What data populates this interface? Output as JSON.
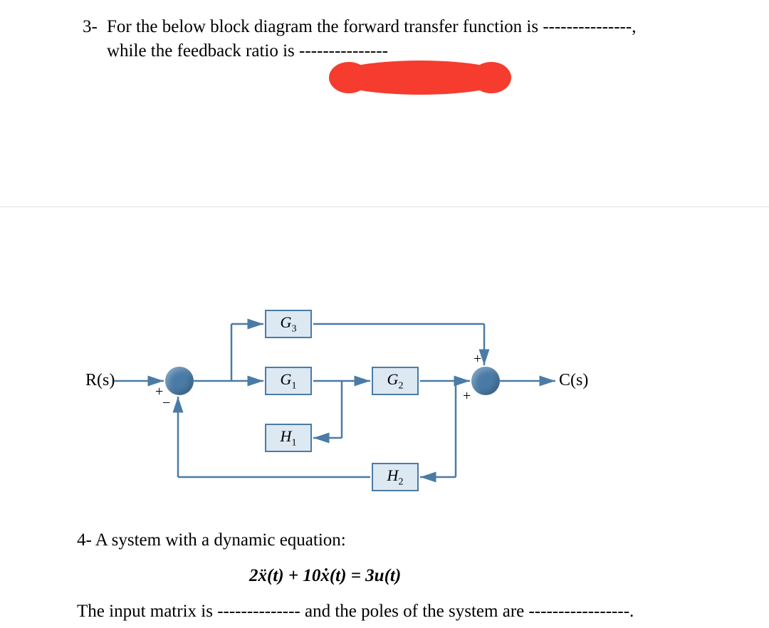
{
  "q3": {
    "number": "3-",
    "line1": "For the below block diagram the forward transfer function is ---------------,",
    "line2": "while the feedback ratio is ---------------"
  },
  "diagram": {
    "input_label": "R(s)",
    "output_label": "C(s)",
    "blocks": {
      "g1": "G",
      "g1_sub": "1",
      "g2": "G",
      "g2_sub": "2",
      "g3": "G",
      "g3_sub": "3",
      "h1": "H",
      "h1_sub": "1",
      "h2": "H",
      "h2_sub": "2"
    },
    "signs": {
      "sum1_top": "+",
      "sum1_bottom": "−",
      "sum2_top": "+",
      "sum2_bottom": "+"
    }
  },
  "q4": {
    "line1": "4- A system with a dynamic equation:",
    "eq_prefix": "2",
    "eq_x1": "ẍ",
    "eq_t1": "(t) + 10",
    "eq_x2": "ẋ",
    "eq_t2": "(t) = 3u(t)",
    "line3_a": "The input matrix is -------------- and the poles of the system are -----------------."
  }
}
